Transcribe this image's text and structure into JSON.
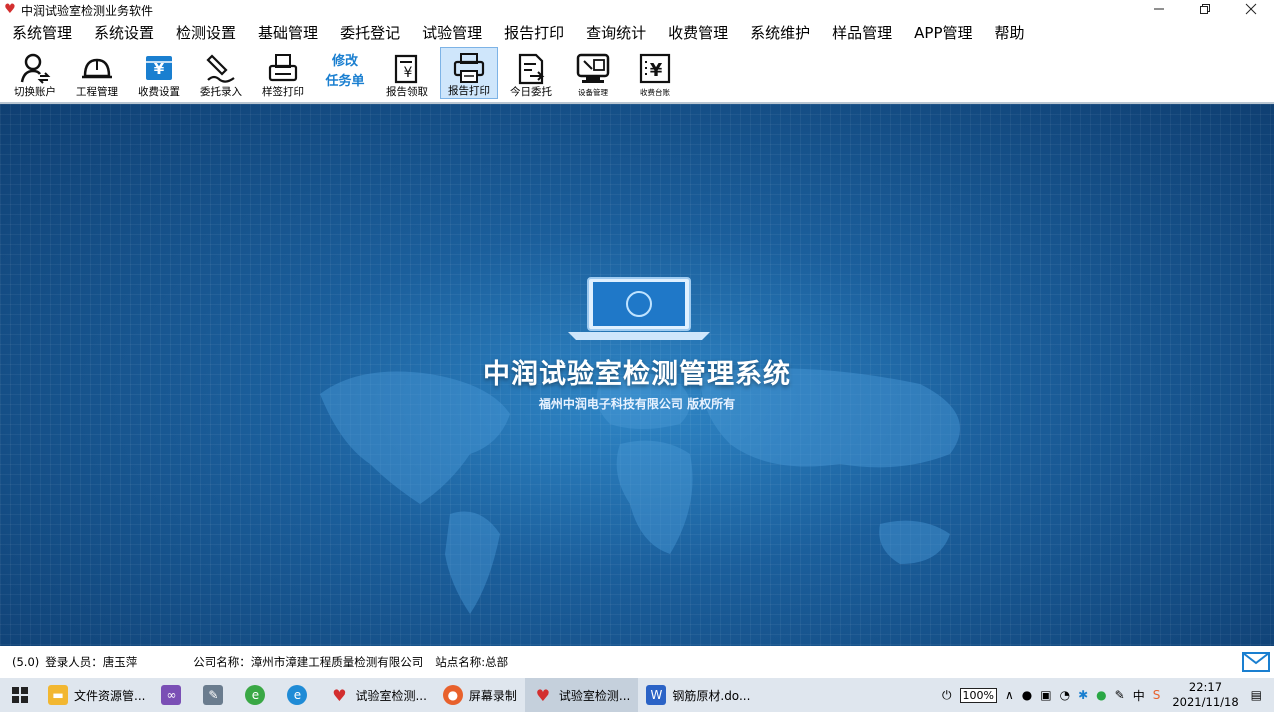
{
  "window": {
    "title": "中润试验室检测业务软件"
  },
  "menu": [
    "系统管理",
    "系统设置",
    "检测设置",
    "基础管理",
    "委托登记",
    "试验管理",
    "报告打印",
    "查询统计",
    "收费管理",
    "系统维护",
    "样品管理",
    "APP管理",
    "帮助"
  ],
  "toolbar": {
    "switch_account": "切换账户",
    "project_mgmt": "工程管理",
    "fee_settings": "收费设置",
    "entrust_input": "委托录入",
    "label_print": "样签打印",
    "modify_task_line1": "修改",
    "modify_task_line2": "任务单",
    "report_collect": "报告领取",
    "report_print": "报告打印",
    "today_entrust": "今日委托",
    "device_mgmt": "设备管理",
    "fee_ledger": "收费台账"
  },
  "splash": {
    "title": "中润试验室检测管理系统",
    "subtitle": "福州中润电子科技有限公司 版权所有"
  },
  "status": {
    "version": "(5.0)",
    "login": "登录人员：唐玉萍",
    "company": "公司名称：漳州市漳建工程质量检测有限公司",
    "site": "站点名称:总部"
  },
  "taskbar": {
    "explorer": "文件资源管...",
    "lab1": "试验室检测...",
    "recorder": "屏幕录制",
    "lab2": "试验室检测...",
    "word": "钢筋原材.do...",
    "battery": "100%",
    "ime": "中",
    "time": "22:17",
    "date": "2021/11/18"
  },
  "colors": {
    "accent": "#1a7fd0",
    "bg_dark": "#0f3f72",
    "active_tool": "#cfe6fb"
  }
}
